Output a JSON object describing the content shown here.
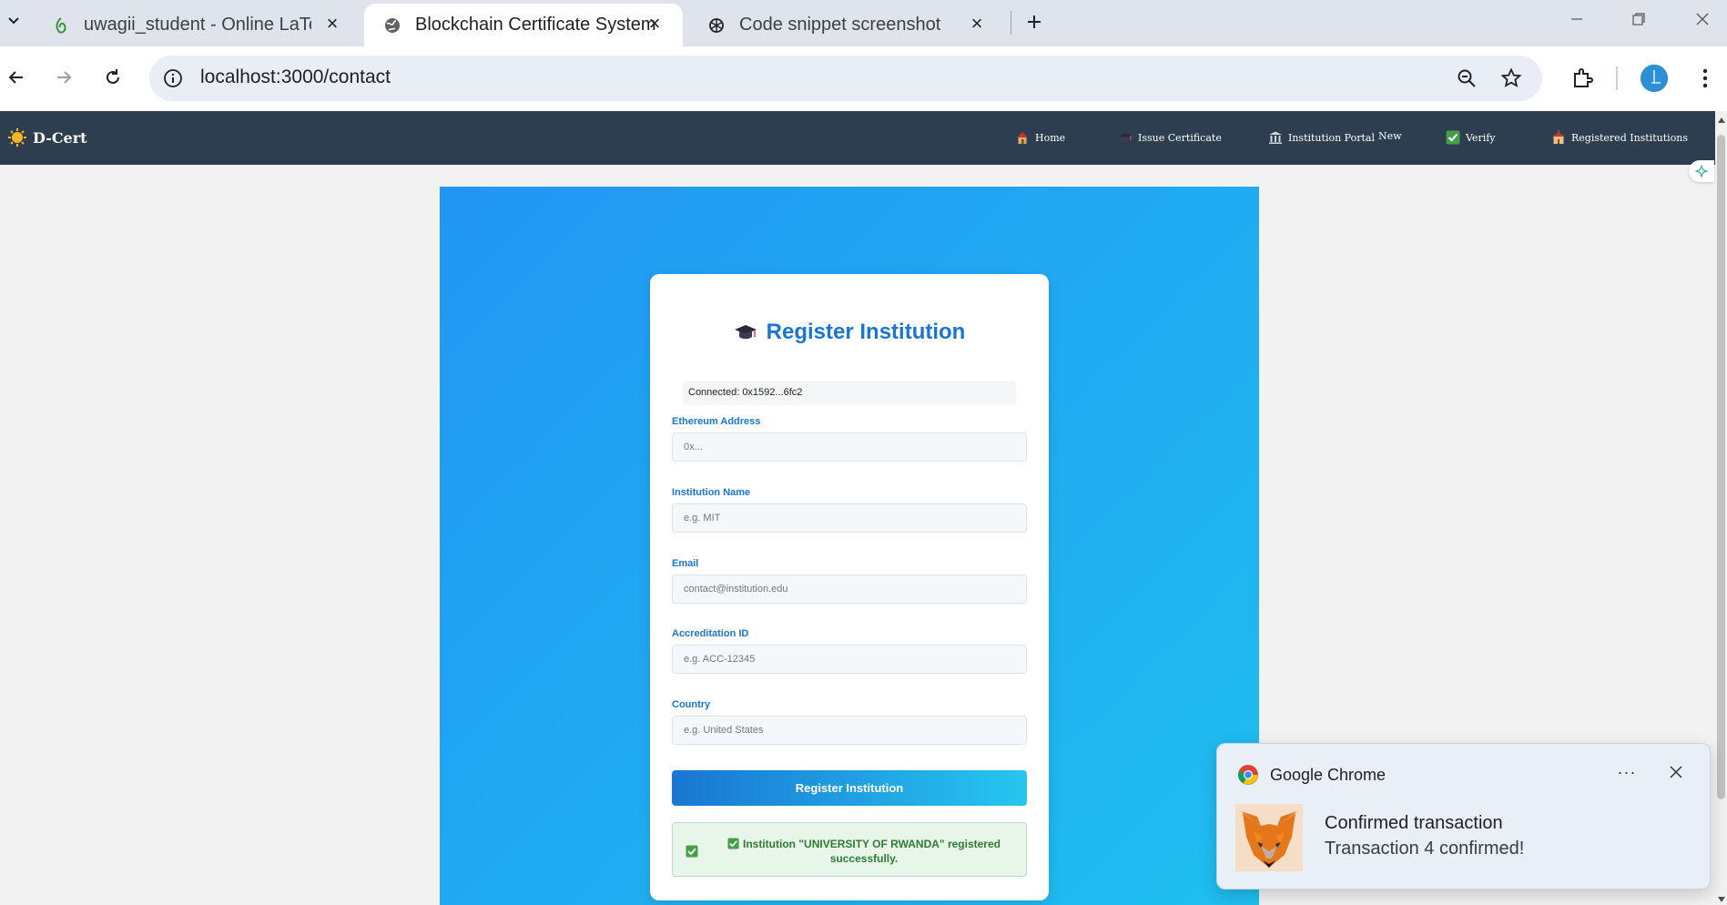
{
  "browser": {
    "tabs": [
      {
        "title": "uwagii_student - Online LaTeX E",
        "icon": "overleaf-icon"
      },
      {
        "title": "Blockchain Certificate System",
        "icon": "globe-icon"
      },
      {
        "title": "Code snippet screenshot",
        "icon": "openai-icon"
      }
    ],
    "url": "localhost:3000/contact"
  },
  "site": {
    "brand": "D-Cert",
    "nav": [
      {
        "label": "Home",
        "icon": "house-icon"
      },
      {
        "label": "Issue Certificate",
        "icon": "graduation-cap-icon"
      },
      {
        "label": "Institution Portal",
        "icon": "bank-icon"
      },
      {
        "label": "New",
        "icon": ""
      },
      {
        "label": "Verify",
        "icon": "check-icon"
      },
      {
        "label": "Registered Institutions",
        "icon": "school-icon"
      }
    ]
  },
  "form": {
    "title": "Register Institution",
    "connected": "Connected: 0x1592...6fc2",
    "fields": [
      {
        "label": "Ethereum Address",
        "placeholder": "0x..."
      },
      {
        "label": "Institution Name",
        "placeholder": "e.g. MIT"
      },
      {
        "label": "Email",
        "placeholder": "contact@institution.edu"
      },
      {
        "label": "Accreditation ID",
        "placeholder": "e.g. ACC-12345"
      },
      {
        "label": "Country",
        "placeholder": "e.g. United States"
      }
    ],
    "submit_label": "Register Institution",
    "success_message": "Institution \"UNIVERSITY OF RWANDA\" registered successfully."
  },
  "notification": {
    "app": "Google Chrome",
    "more": "···",
    "title": "Confirmed transaction",
    "body": "Transaction 4 confirmed!"
  },
  "colors": {
    "navbar": "#2c3e50",
    "accent": "#1976d2",
    "hero_start": "#2196f3",
    "hero_end": "#1fbff0",
    "success_text": "#2e7d32"
  }
}
